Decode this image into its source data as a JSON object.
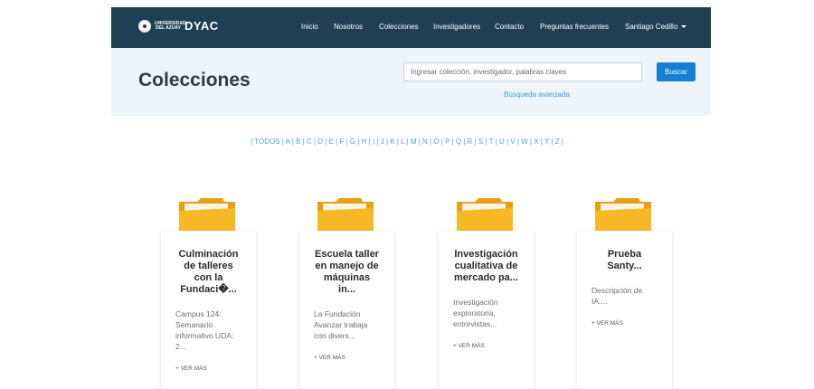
{
  "nav": {
    "brand_small": "UNIVERSIDAD DEL AZUAY",
    "brand": "DYAC",
    "items": [
      "Inicio",
      "Nosotros",
      "Colecciones",
      "Investigadores",
      "Contacto",
      "Preguntas frecuentes"
    ],
    "user": "Santiago Cedillo"
  },
  "header": {
    "title": "Colecciones",
    "search_placeholder": "Ingresar colección, investigador, palabras claves",
    "search_button": "Buscar",
    "advanced_search": "Búsqueda avanzada"
  },
  "alphabet": [
    "TODOS",
    "A",
    "B",
    "C",
    "D",
    "E",
    "F",
    "G",
    "H",
    "I",
    "J",
    "K",
    "L",
    "M",
    "N",
    "O",
    "P",
    "Q",
    "R",
    "S",
    "T",
    "U",
    "V",
    "W",
    "X",
    "Y",
    "Z"
  ],
  "cards": [
    {
      "title": "Culminación de talleres con la Fundaci�...",
      "description": "Campus 124: Semanario informativo UDA: 2...",
      "more": "+ VER MÁS"
    },
    {
      "title": "Escuela taller en manejo de máquinas in...",
      "description": "La Fundación Avanzar trabaja con divers...",
      "more": "+ VER MÁS"
    },
    {
      "title": "Investigación cualitativa de mercado pa...",
      "description": "Investigación exploratoria, entrevistas...",
      "more": "+ VER MÁS"
    },
    {
      "title": "Prueba Santy...",
      "description": "Descripción de IA....",
      "more": "+ VER MÁS"
    }
  ],
  "colors": {
    "navbar": "#1f3f52",
    "hero": "#eef5fa",
    "accent": "#1380d6",
    "link": "#4da3de",
    "folder": "#f5b51c"
  },
  "icons": {
    "logo": "university-seal-icon",
    "user_menu": "caret-down-icon",
    "card": "folder-icon"
  }
}
